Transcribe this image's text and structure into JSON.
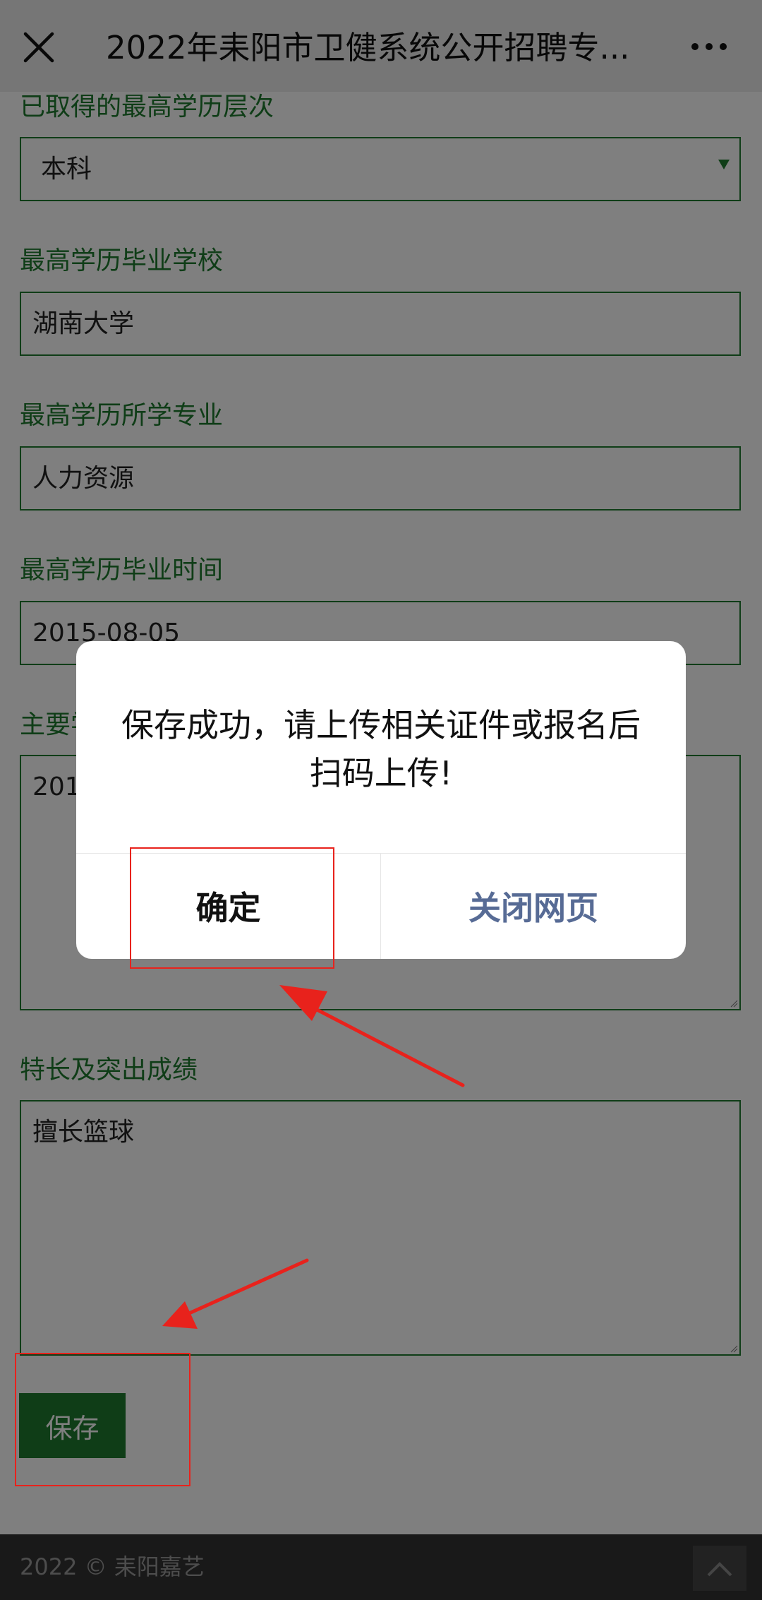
{
  "header": {
    "title": "2022年耒阳市卫健系统公开招聘专...",
    "close_icon": "close-icon",
    "more_icon": "more-dots-icon"
  },
  "form": {
    "education_level": {
      "label": "已取得的最高学历层次",
      "value": "本科"
    },
    "school": {
      "label": "最高学历毕业学校",
      "value": "湖南大学"
    },
    "major": {
      "label": "最高学历所学专业",
      "value": "人力资源"
    },
    "grad_date": {
      "label": "最高学历毕业时间",
      "value": "2015-08-05"
    },
    "resume": {
      "label": "主要学",
      "value": "201"
    },
    "specialty": {
      "label": "特长及突出成绩",
      "value": "擅长篮球"
    },
    "save_label": "保存"
  },
  "footer": {
    "copyright": "2022 © 耒阳嘉艺",
    "top_icon": "chevron-up-icon"
  },
  "dialog": {
    "message": "保存成功，请上传相关证件或报名后扫码上传!",
    "confirm_label": "确定",
    "close_label": "关闭网页"
  },
  "colors": {
    "accent_green": "#1e7a2e",
    "dialog_link_blue": "#576b95",
    "annotation_red": "#e8221c"
  }
}
